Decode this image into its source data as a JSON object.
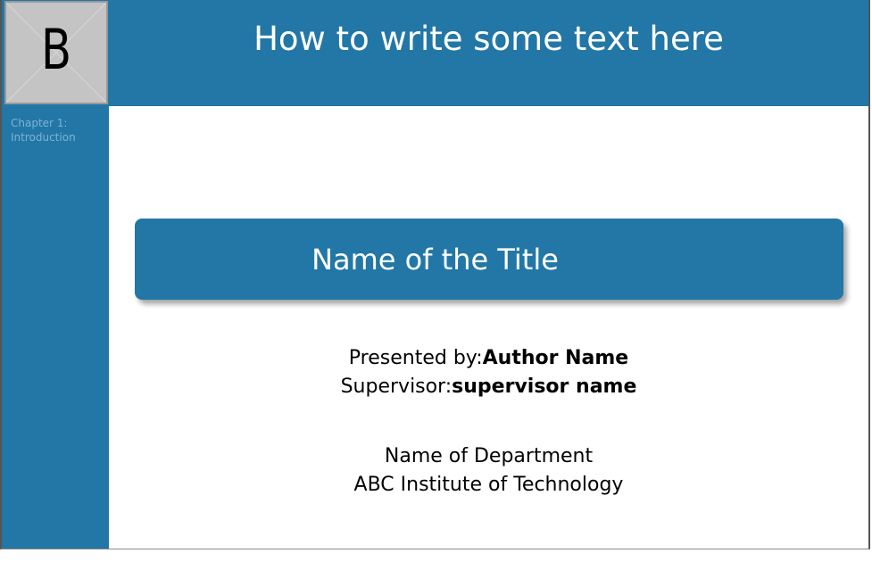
{
  "slide": {
    "header_title": "How to write some text here",
    "logo_letter": "B",
    "nav": {
      "chapter": "Chapter 1:",
      "section": "Introduction"
    },
    "title": "Name of the Title",
    "presented_label": "Presented by:",
    "author": "Author Name",
    "supervisor_label": "Supervisor:",
    "supervisor": "supervisor name",
    "department": "Name of Department",
    "institute": "ABC Institute of Technology"
  },
  "colors": {
    "accent": "#2277a6",
    "nav_text": "#7fb2d0",
    "logo_bg": "#c4c4c4"
  }
}
